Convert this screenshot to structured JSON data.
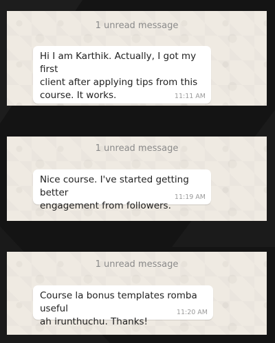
{
  "cards": [
    {
      "unread_label": "1 unread message",
      "message": "Hi I am Karthik. Actually, I got my first\nclient after applying tips from this\ncourse. It works.",
      "time": "11:11 AM"
    },
    {
      "unread_label": "1 unread message",
      "message": "Nice course. I've started getting better\nengagement from followers.",
      "time": "11:19 AM"
    },
    {
      "unread_label": "1 unread message",
      "message": "Course la bonus templates romba useful\nah irunthuchu. Thanks!",
      "time": "11:20 AM"
    }
  ],
  "colors": {
    "page_background": "#141414",
    "card_background": "#efeae2",
    "bubble_background": "#ffffff",
    "unread_text": "#8a8a8a",
    "message_text": "#202020",
    "timestamp_text": "#9a9a9a"
  }
}
